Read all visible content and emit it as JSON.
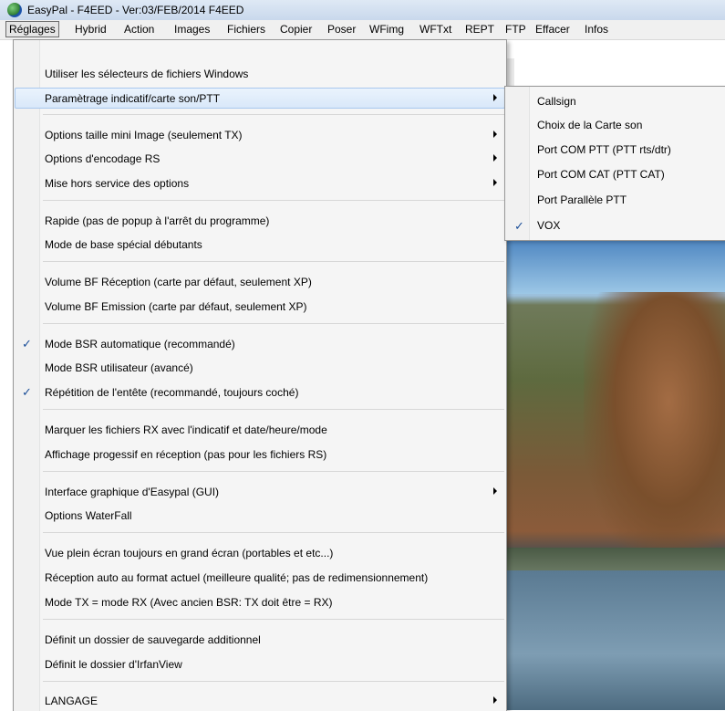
{
  "window": {
    "title": "EasyPal - F4EED - Ver:03/FEB/2014   F4EED"
  },
  "menubar": [
    {
      "label": "Réglages",
      "active": true
    },
    {
      "label": "Hybrid"
    },
    {
      "label": "Action"
    },
    {
      "label": "Images"
    },
    {
      "label": "Fichiers"
    },
    {
      "label": "Copier"
    },
    {
      "label": "Poser"
    },
    {
      "label": "WFimg"
    },
    {
      "label": "WFTxt"
    },
    {
      "label": "REPT"
    },
    {
      "label": "FTP"
    },
    {
      "label": "Effacer"
    },
    {
      "label": "Infos"
    }
  ],
  "reglages_menu": {
    "items": [
      {
        "label": "Utiliser les sélecteurs de fichiers Windows"
      },
      {
        "label": "Paramètrage indicatif/carte son/PTT",
        "submenu": true,
        "highlighted": true
      },
      {
        "label": "Options taille mini Image (seulement TX)",
        "submenu": true
      },
      {
        "label": "Options d'encodage RS",
        "submenu": true
      },
      {
        "label": "Mise hors service des options",
        "submenu": true
      },
      {
        "label": "Rapide (pas de popup à l'arrêt du programme)"
      },
      {
        "label": "Mode de base spécial débutants"
      },
      {
        "label": "Volume BF Réception (carte par défaut, seulement XP)"
      },
      {
        "label": "Volume BF Emission (carte par défaut, seulement XP)"
      },
      {
        "label": "Mode BSR automatique (recommandé)",
        "checked": true
      },
      {
        "label": "Mode BSR utilisateur (avancé)"
      },
      {
        "label": "Répétition de l'entête (recommandé, toujours coché)",
        "checked": true
      },
      {
        "label": "Marquer les fichiers RX avec l'indicatif et date/heure/mode"
      },
      {
        "label": "Affichage progessif en réception (pas pour les fichiers RS)"
      },
      {
        "label": "Interface graphique d'Easypal (GUI)",
        "submenu": true
      },
      {
        "label": "Options WaterFall"
      },
      {
        "label": "Vue plein écran toujours en grand écran (portables et etc...)"
      },
      {
        "label": "Réception auto au format actuel (meilleure qualité; pas de redimensionnement)"
      },
      {
        "label": "Mode TX = mode RX (Avec ancien BSR: TX doit être = RX)"
      },
      {
        "label": "Définit un dossier de sauvegarde additionnel"
      },
      {
        "label": "Définit le dossier d'IrfanView"
      },
      {
        "label": "LANGAGE",
        "submenu": true
      }
    ]
  },
  "submenu_parametrage": {
    "items": [
      {
        "label": "Callsign"
      },
      {
        "label": "Choix de la Carte son"
      },
      {
        "label": "Port COM PTT (PTT rts/dtr)"
      },
      {
        "label": "Port COM CAT  (PTT CAT)"
      },
      {
        "label": "Port Parallèle PTT"
      },
      {
        "label": "VOX",
        "checked": true
      }
    ]
  },
  "glyphs": {
    "check": "✓"
  }
}
